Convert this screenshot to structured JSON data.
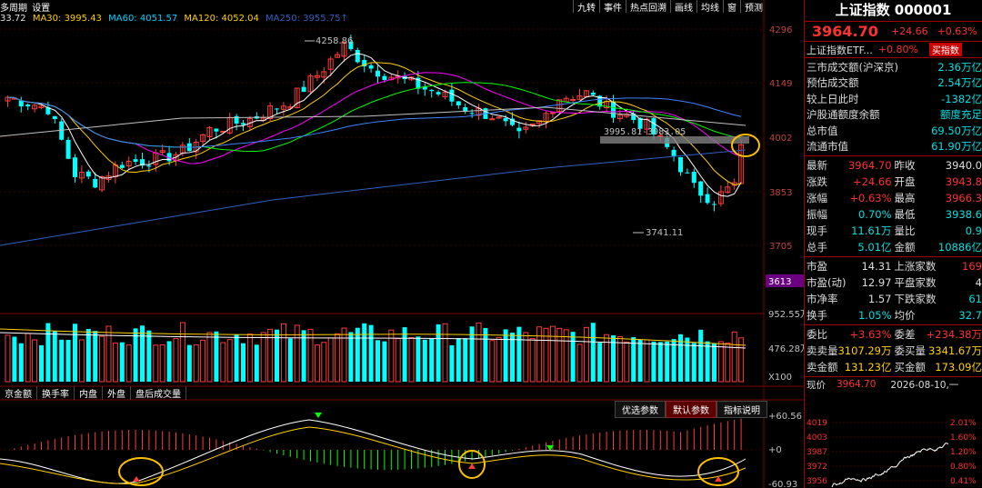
{
  "topbar": {
    "tabs": [
      "多周期",
      "设置"
    ]
  },
  "ma_legend": [
    {
      "label": "33.72",
      "color": "#e0e0e0"
    },
    {
      "label": "MA30: 3995.43",
      "color": "#ffd000"
    },
    {
      "label": "MA60: 4051.57",
      "color": "#00d0ff"
    },
    {
      "label": "MA120: 4052.04",
      "color": "#ffd000"
    },
    {
      "label": "MA250: 3955.75↑",
      "color": "#3060c0"
    }
  ],
  "toolbar": {
    "items": [
      "九转",
      "事件",
      "热点回溯",
      "画线",
      "均线",
      "窗",
      "预测"
    ]
  },
  "price_axis": [
    "4296",
    "4149",
    "4002",
    "3853",
    "3705"
  ],
  "current_price_tag": "3613",
  "annotations": {
    "high": "4258.86",
    "low": "3741.11",
    "gap": "3995.81-3983.05"
  },
  "volume_axis": [
    "952.55万",
    "476.28万",
    "X100"
  ],
  "volume_tabs": [
    "京金额",
    "换手率",
    "内盘",
    "外盘",
    "盘后成交量"
  ],
  "macd_tabs": [
    {
      "label": "优选参数",
      "active": false
    },
    {
      "label": "默认参数",
      "active": true
    },
    {
      "label": "指标说明",
      "active": false
    }
  ],
  "macd_axis": [
    "+60.56",
    "+0",
    "-60.93"
  ],
  "info": {
    "title": "上证指数 000001",
    "price": "3964.70",
    "change": "+24.66",
    "change_pct": "+0.63%",
    "etf_label": "上证指数ETF...",
    "etf_pct": "+0.80%",
    "etf_button": "买指数",
    "summary": [
      {
        "label": "三市成交额(沪深京)",
        "value": "2.36万亿",
        "red": false
      },
      {
        "label": "预估成交额",
        "value": "2.54万亿",
        "red": false
      },
      {
        "label": "较上日此时",
        "value": "-1382亿",
        "red": false
      },
      {
        "label": "沪股通额度余额",
        "value": "额度充足",
        "red": false
      },
      {
        "label": "总市值",
        "value": "69.50万亿",
        "red": false
      },
      {
        "label": "流通市值",
        "value": "61.90万亿",
        "red": false
      }
    ],
    "quote1": [
      {
        "l1": "最新",
        "v1": "3964.70",
        "c1": "red",
        "l2": "昨收",
        "v2": "3940.0",
        "c2": "white"
      },
      {
        "l1": "涨跌",
        "v1": "+24.66",
        "c1": "red",
        "l2": "开盘",
        "v2": "3943.8",
        "c2": "red"
      },
      {
        "l1": "涨幅",
        "v1": "+0.63%",
        "c1": "red",
        "l2": "最高",
        "v2": "3966.3",
        "c2": "red"
      },
      {
        "l1": "振幅",
        "v1": "0.70%",
        "c1": "cyan",
        "l2": "最低",
        "v2": "3938.6",
        "c2": "cyan"
      },
      {
        "l1": "现手",
        "v1": "11.61万",
        "c1": "cyan",
        "l2": "量比",
        "v2": "0.9",
        "c2": "cyan"
      },
      {
        "l1": "总手",
        "v1": "5.01亿",
        "c1": "cyan",
        "l2": "金额",
        "v2": "10886亿",
        "c2": "cyan"
      }
    ],
    "quote2": [
      {
        "l1": "市盈",
        "v1": "14.31",
        "c1": "white",
        "l2": "上涨家数",
        "v2": "169",
        "c2": "red"
      },
      {
        "l1": "市盈(动)",
        "v1": "12.97",
        "c1": "white",
        "l2": "平盘家数",
        "v2": "4",
        "c2": "white"
      },
      {
        "l1": "市净率",
        "v1": "1.57",
        "c1": "white",
        "l2": "下跌家数",
        "v2": "61",
        "c2": "cyan"
      },
      {
        "l1": "换手",
        "v1": "1.05%",
        "c1": "cyan",
        "l2": "均价",
        "v2": "32.7",
        "c2": "cyan"
      }
    ],
    "quote3": [
      {
        "l1": "委比",
        "v1": "+3.63%",
        "c1": "red",
        "l2": "委差",
        "v2": "+234.38万",
        "c2": "red"
      },
      {
        "l1": "卖卖量",
        "v1": "3107.29万",
        "c1": "yellow",
        "l2": "委买量",
        "v2": "3341.67万",
        "c2": "yellow"
      },
      {
        "l1": "卖金额",
        "v1": "131.23亿",
        "c1": "yellow",
        "l2": "买金额",
        "v2": "173.09亿",
        "c2": "yellow"
      }
    ],
    "mini": {
      "label": "现价",
      "price": "3964.70",
      "date": "2026-08-10,一",
      "left_axis": [
        "4019",
        "4003",
        "3987",
        "3972",
        "3956"
      ],
      "right_axis": [
        "2.01%",
        "1.60%",
        "1.20%",
        "0.80%",
        "0.41%"
      ]
    }
  }
}
